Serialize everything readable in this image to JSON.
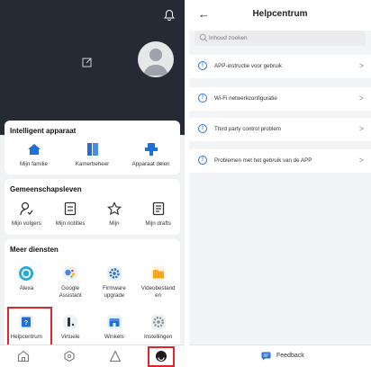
{
  "left_panel": {
    "header": {
      "bell_icon": "bell-icon",
      "edit_icon": "edit-icon",
      "avatar": "user-avatar"
    },
    "intelligent_device": {
      "title": "Intelligent apparaat",
      "items": [
        {
          "label": "Mijn familie",
          "icon": "home-icon",
          "color": "#1f6fd6"
        },
        {
          "label": "Kamerbeheer",
          "icon": "room-icon",
          "color": "#1f6fd6"
        },
        {
          "label": "Apparaat delen",
          "icon": "share-device-icon",
          "color": "#1f6fd6"
        }
      ]
    },
    "community": {
      "title": "Gemeenschapsleven",
      "items": [
        {
          "label": "Mijn volgers",
          "icon": "followers-icon"
        },
        {
          "label": "Mijn notities",
          "icon": "notes-icon"
        },
        {
          "label": "Mijn",
          "icon": "star-icon"
        },
        {
          "label": "Mijn drafts",
          "icon": "drafts-icon"
        }
      ]
    },
    "more_services": {
      "title": "Meer diensten",
      "row1": [
        {
          "label": "Alexa",
          "icon": "alexa-icon"
        },
        {
          "label": "Google\nAssistant",
          "icon": "google-assistant-icon"
        },
        {
          "label": "Firmware\nupgrade",
          "icon": "firmware-icon"
        },
        {
          "label": "Videobestand\nen",
          "icon": "video-files-icon"
        }
      ],
      "row2": [
        {
          "label": "Helpcentrum",
          "icon": "help-center-icon"
        },
        {
          "label": "Virtuele",
          "icon": "virtual-icon"
        },
        {
          "label": "Winkels",
          "icon": "shop-icon"
        },
        {
          "label": "Instellingen",
          "icon": "settings-icon"
        }
      ]
    },
    "tabbar": [
      "home-tab-icon",
      "discover-tab-icon",
      "smart-tab-icon",
      "profile-tab-icon"
    ]
  },
  "right_panel": {
    "title": "Helpcentrum",
    "back": "←",
    "search_placeholder": "Inhoud zoeken",
    "items": [
      {
        "label": "APP-instructie voor gebruik",
        "icon_glyph": "!",
        "chevron": ">"
      },
      {
        "label": "Wi-Fi netwerkconfiguratie",
        "icon_glyph": "!",
        "chevron": ">"
      },
      {
        "label": "Third party control problem",
        "icon_glyph": "!",
        "chevron": ">"
      },
      {
        "label": "Problemen met het gebruik van de APP",
        "icon_glyph": "!",
        "chevron": ">"
      }
    ],
    "feedback_label": "Feedback"
  },
  "colors": {
    "accent": "#2f6fd8",
    "highlight": "#e0262a",
    "header_dark": "#252a34"
  }
}
